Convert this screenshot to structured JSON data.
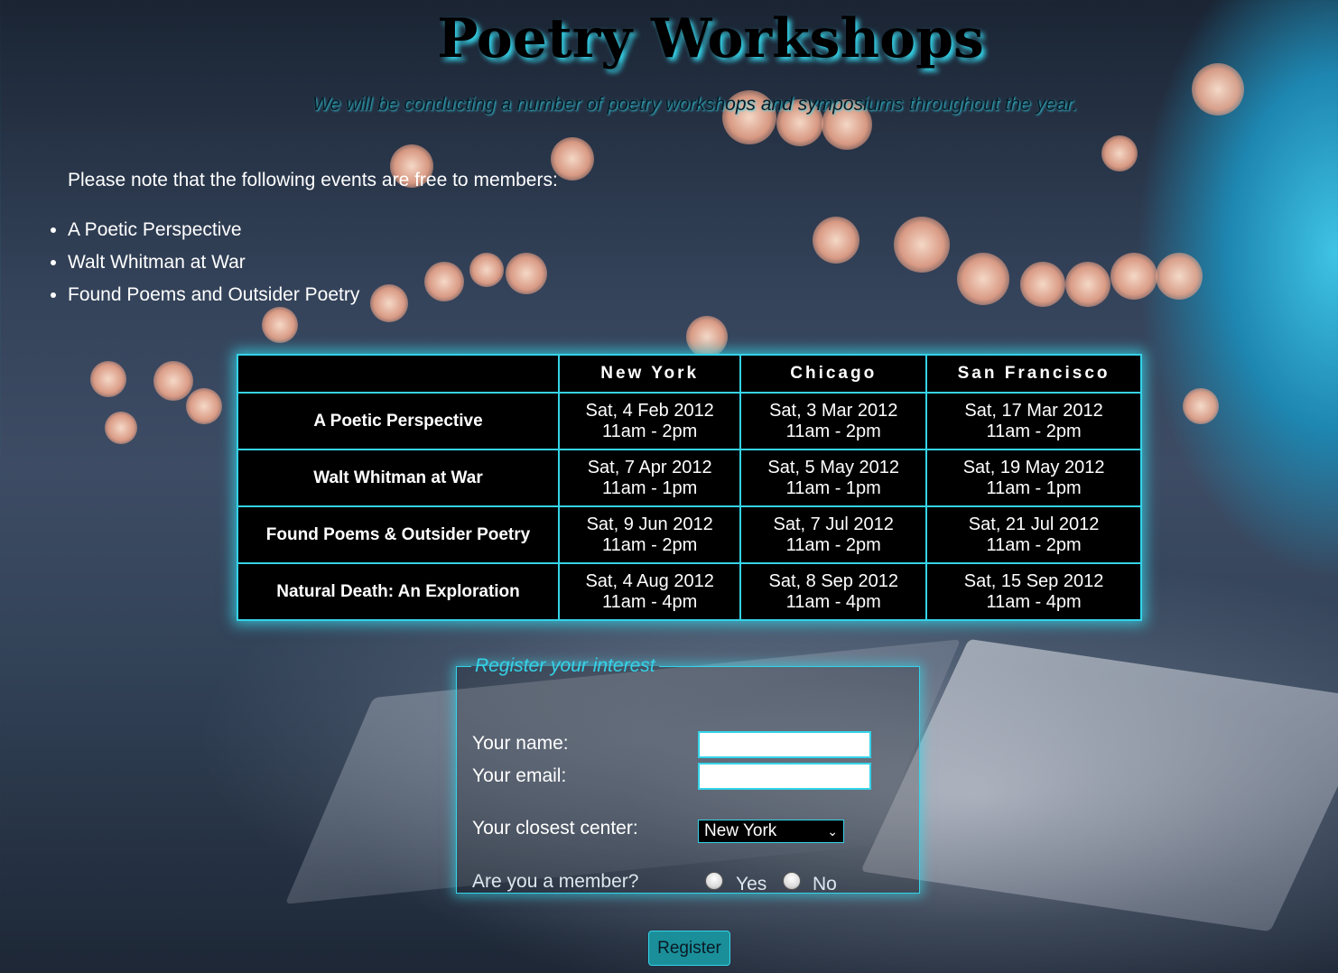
{
  "page": {
    "title": "Poetry Workshops",
    "subtitle": "We will be conducting a number of poetry workshops and symposiums throughout the year.",
    "note": "Please note that the following events are free to members:",
    "free_events": [
      "A Poetic Perspective",
      "Walt Whitman at War",
      "Found Poems and Outsider Poetry"
    ]
  },
  "schedule": {
    "headers": [
      "",
      "New York",
      "Chicago",
      "San Francisco"
    ],
    "rows": [
      {
        "event": "A Poetic Perspective",
        "sessions": [
          {
            "date": "Sat, 4 Feb 2012",
            "time": "11am - 2pm"
          },
          {
            "date": "Sat, 3 Mar 2012",
            "time": "11am - 2pm"
          },
          {
            "date": "Sat, 17 Mar 2012",
            "time": "11am - 2pm"
          }
        ]
      },
      {
        "event": "Walt Whitman at War",
        "sessions": [
          {
            "date": "Sat, 7 Apr 2012",
            "time": "11am - 1pm"
          },
          {
            "date": "Sat, 5 May 2012",
            "time": "11am - 1pm"
          },
          {
            "date": "Sat, 19 May 2012",
            "time": "11am - 1pm"
          }
        ]
      },
      {
        "event": "Found Poems & Outsider Poetry",
        "sessions": [
          {
            "date": "Sat, 9 Jun 2012",
            "time": "11am - 2pm"
          },
          {
            "date": "Sat, 7 Jul 2012",
            "time": "11am - 2pm"
          },
          {
            "date": "Sat, 21 Jul 2012",
            "time": "11am - 2pm"
          }
        ]
      },
      {
        "event": "Natural Death: An Exploration",
        "sessions": [
          {
            "date": "Sat, 4 Aug 2012",
            "time": "11am - 4pm"
          },
          {
            "date": "Sat, 8 Sep 2012",
            "time": "11am - 4pm"
          },
          {
            "date": "Sat, 15 Sep 2012",
            "time": "11am - 4pm"
          }
        ]
      }
    ]
  },
  "form": {
    "legend": "Register your interest",
    "name_label": "Your name:",
    "name_value": "",
    "email_label": "Your email:",
    "email_value": "",
    "center_label": "Your closest center:",
    "center_selected": "New York",
    "member_label": "Are you a member?",
    "member_yes": "Yes",
    "member_no": "No",
    "submit_label": "Register"
  },
  "colors": {
    "accent": "#35d3e8",
    "button": "#1a8f9a",
    "table_bg": "#000000"
  }
}
